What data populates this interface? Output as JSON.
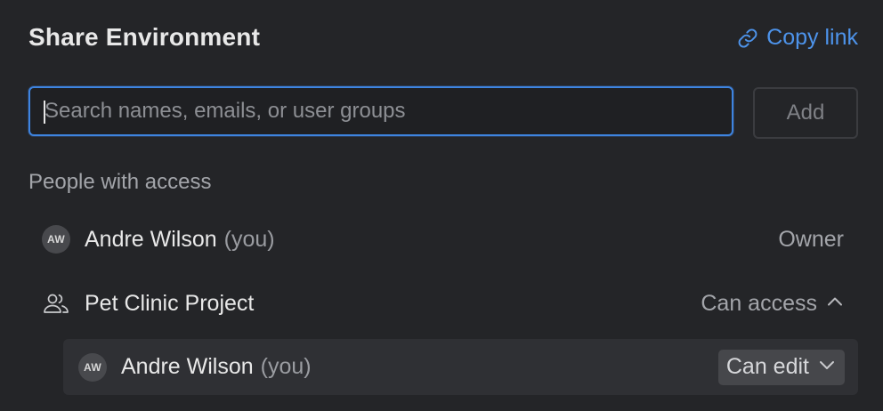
{
  "dialog": {
    "title": "Share Environment",
    "copy_link_label": "Copy link",
    "search_placeholder": "Search names, emails, or user groups",
    "search_value": "",
    "add_label": "Add",
    "section_label": "People with access"
  },
  "people": [
    {
      "initials": "AW",
      "name": "Andre Wilson",
      "suffix": "(you)",
      "role": "Owner"
    }
  ],
  "group": {
    "name": "Pet Clinic Project",
    "access_label": "Can access",
    "expanded": true,
    "members": [
      {
        "initials": "AW",
        "name": "Andre Wilson",
        "suffix": "(you)",
        "permission": "Can edit"
      }
    ]
  },
  "colors": {
    "background": "#242528",
    "accent": "#4d93ea",
    "focus_border": "#3e84e0",
    "sub_row_bg": "#2f3034",
    "select_bg": "#46474b"
  },
  "icons": {
    "copy_link": "link-icon",
    "group": "user-group-icon",
    "collapse": "chevron-up-icon",
    "dropdown": "chevron-down-icon"
  }
}
